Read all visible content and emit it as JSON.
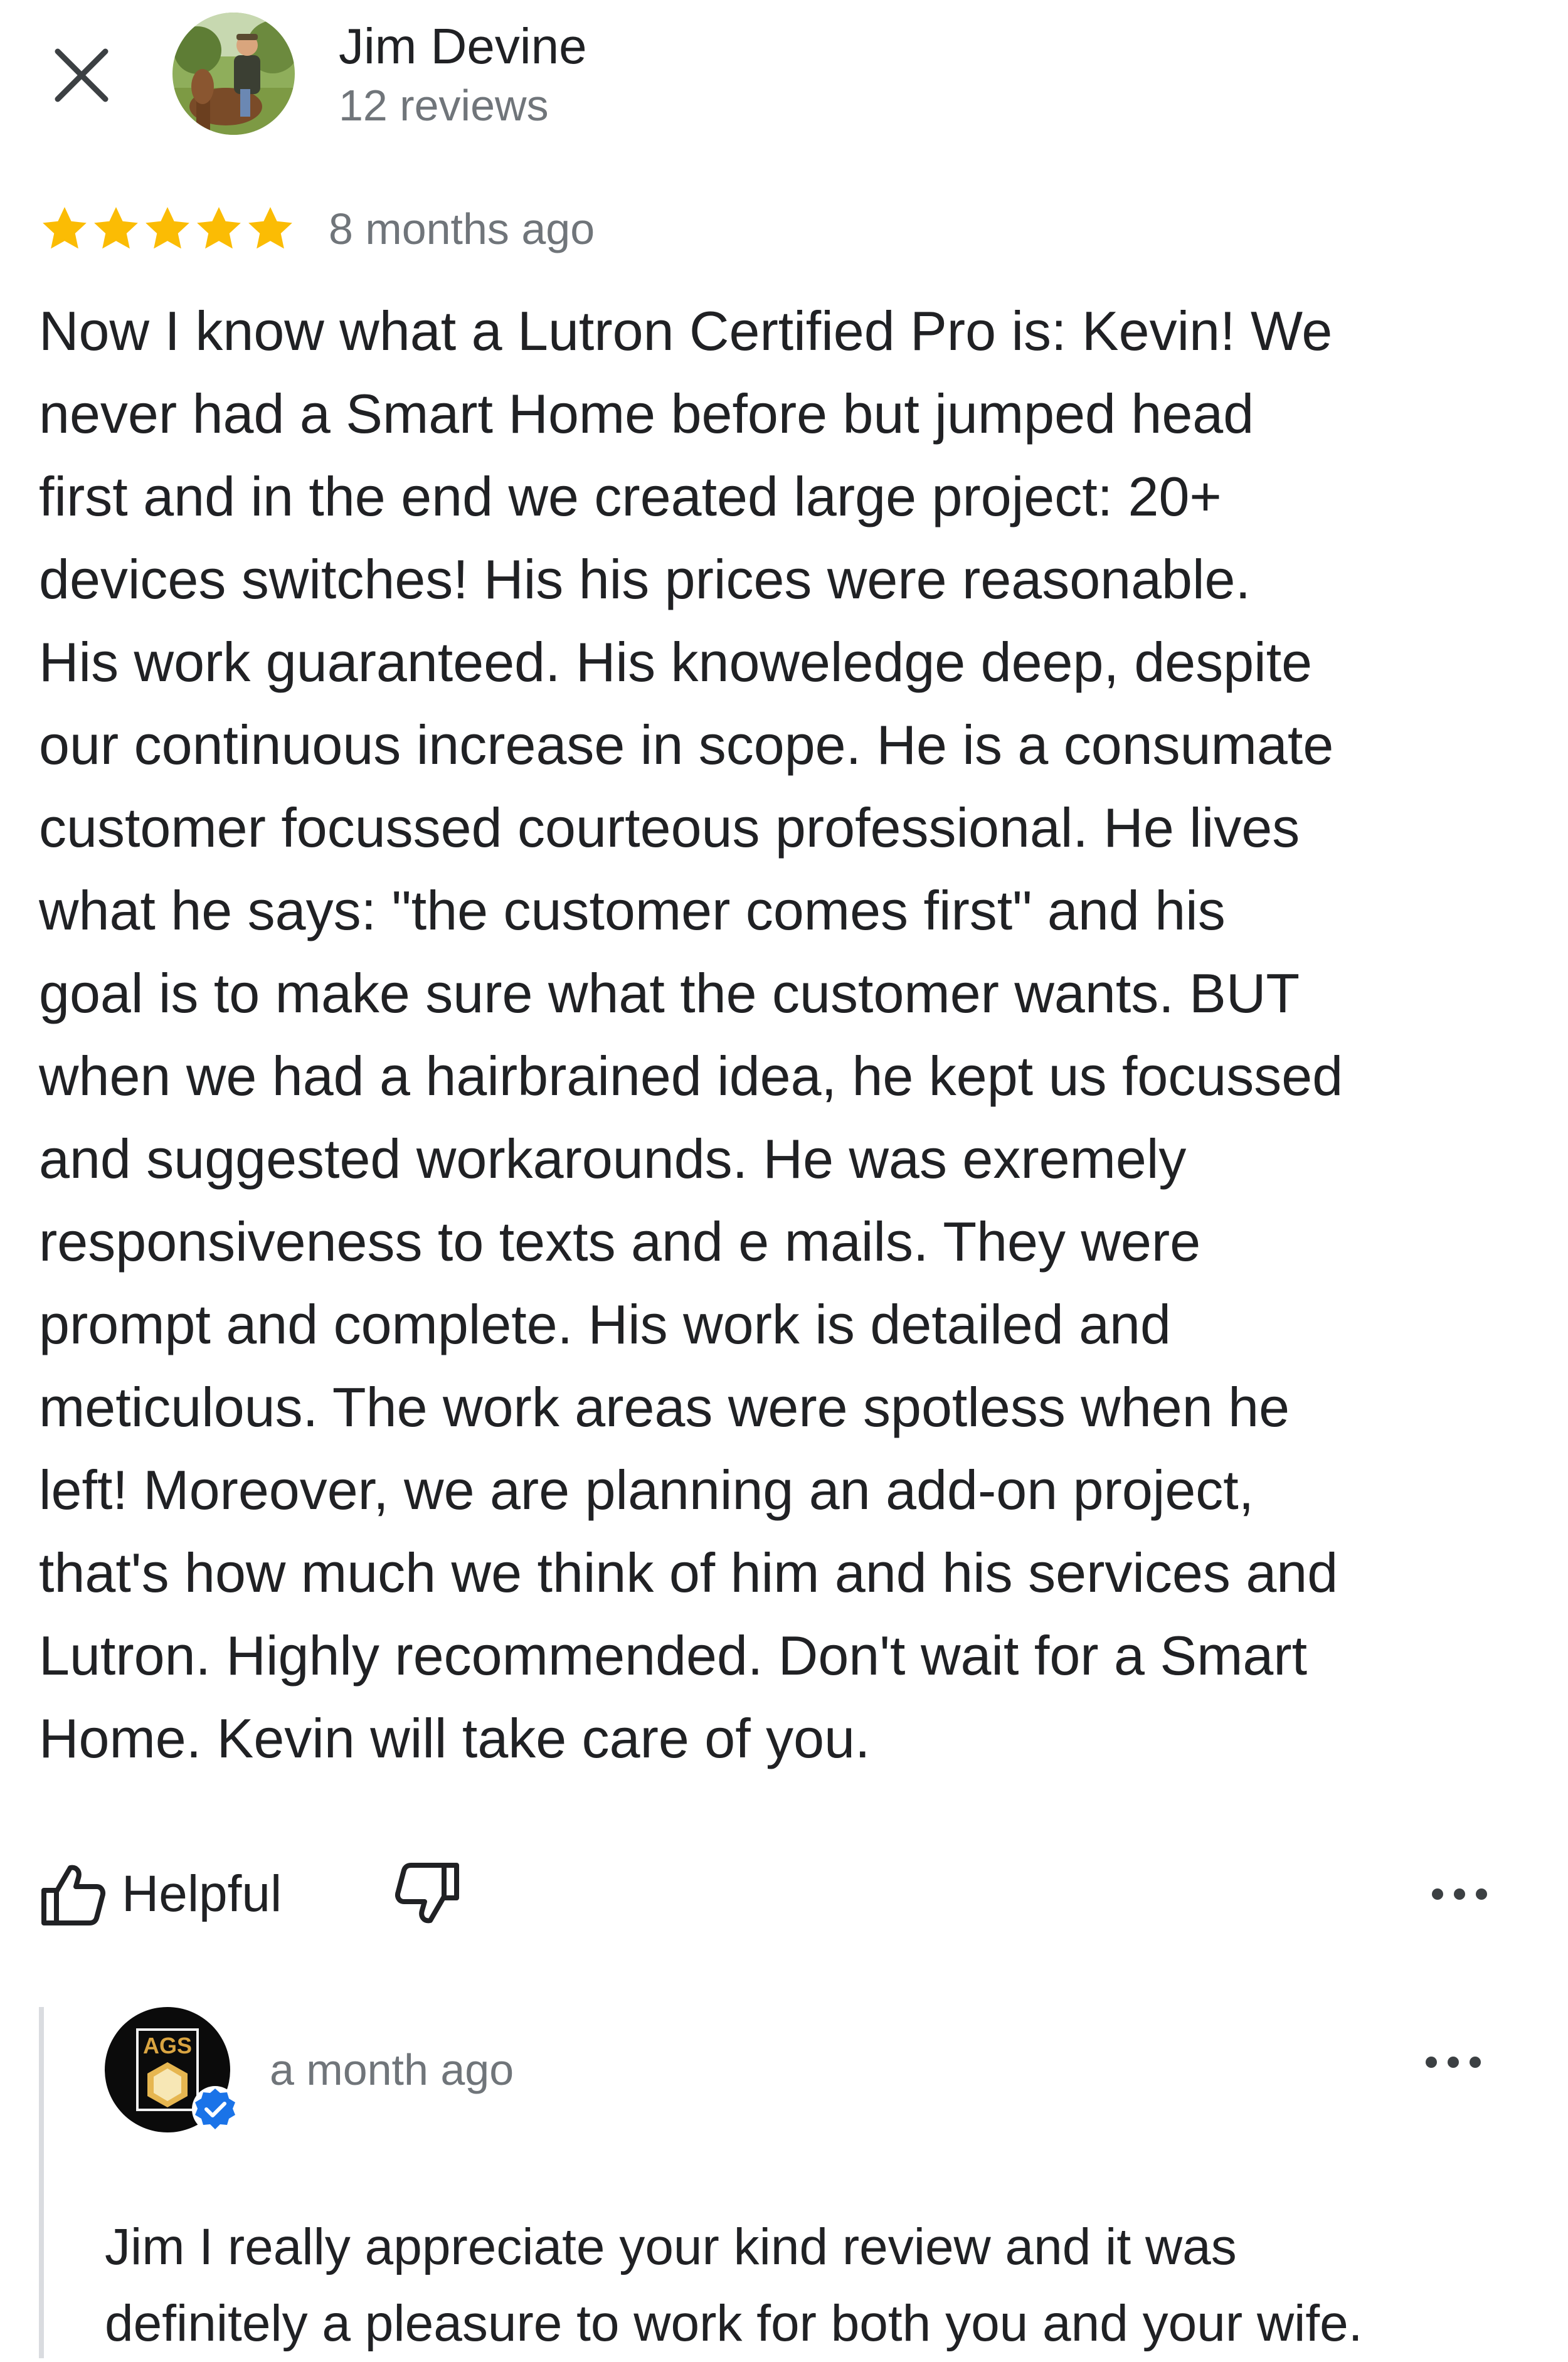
{
  "review": {
    "author_name": "Jim Devine",
    "author_meta": "12 reviews",
    "rating": 5,
    "rating_max": 5,
    "star_color": "#fbbc04",
    "time": "8 months ago",
    "text": "Now I know what a Lutron Certified Pro is: Kevin! We\nnever had a Smart Home before but  jumped head\nfirst and in the end we created large project: 20+\ndevices switches!  His his prices were reasonable.\nHis work guaranteed. His knoweledge deep, despite\nour continuous increase in scope. He is a consumate\ncustomer focussed courteous  professional. He lives\nwhat he says: \"the customer comes first\" and his\ngoal is to make sure what the customer wants. BUT\nwhen we had a hairbrained idea, he kept us focussed\nand suggested workarounds. He was exremely\nresponsiveness to texts and e mails. They were\nprompt and complete. His work is detailed and\nmeticulous. The work areas were spotless when he\nleft! Moreover, we are planning an add-on project,\nthat's how much we think of him and his services and\nLutron. Highly recommended. Don't wait for a Smart\nHome. Kevin will take care of you."
  },
  "actions": {
    "helpful_label": "Helpful"
  },
  "owner_reply": {
    "time": "a month ago",
    "logo_text": "AGS",
    "text": "Jim I really appreciate your kind review and it was\ndefinitely a pleasure to work for both you and your wife."
  },
  "icons": {
    "close": "close-icon",
    "star": "star-icon",
    "thumb_up": "thumb-up-icon",
    "thumb_down": "thumb-down-icon",
    "more": "more-horizontal-icon",
    "verified": "verified-check-icon"
  },
  "colors": {
    "text_primary": "#202124",
    "text_secondary": "#70757a",
    "verified_blue": "#1a73e8",
    "divider": "#dadce0"
  }
}
